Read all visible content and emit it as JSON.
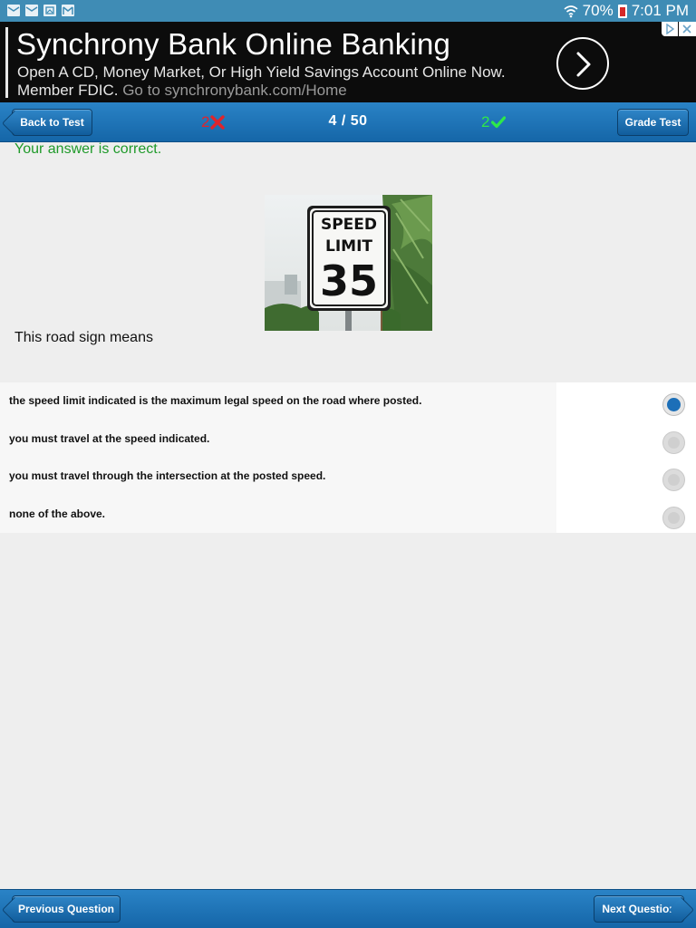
{
  "status_bar": {
    "battery": "70%",
    "time": "7:01 PM",
    "notification_icons": [
      "mail-icon",
      "mail-icon",
      "image-icon",
      "gmail-icon"
    ]
  },
  "ad": {
    "title": "Synchrony Bank Online Banking",
    "line1": "Open A CD, Money Market, Or High Yield Savings Account Online Now.",
    "line2_prefix": "Member FDIC.",
    "line2_url": "Go to synchronybank.com/Home"
  },
  "header": {
    "back_label": "Back to Test",
    "wrong_count": "2",
    "progress": "4 / 50",
    "correct_count": "2",
    "grade_label": "Grade Test"
  },
  "question": {
    "feedback": "Your answer is correct.",
    "sign_line1": "SPEED",
    "sign_line2": "LIMIT",
    "sign_number": "35",
    "prompt": "This road sign means",
    "answers": [
      {
        "text": "the speed limit indicated is the maximum legal speed on the road where posted.",
        "selected": true
      },
      {
        "text": "you must travel at the speed indicated.",
        "selected": false
      },
      {
        "text": "you must travel through the intersection at the posted speed.",
        "selected": false
      },
      {
        "text": "none of the above.",
        "selected": false
      }
    ]
  },
  "footer": {
    "prev_label": "Previous Question",
    "next_label": "Next Question"
  },
  "colors": {
    "bar_blue": "#1a6fb0",
    "correct_green": "#1f9a2a",
    "wrong_red": "#e0242b",
    "check_green": "#2ee84a",
    "selected_radio": "#1c6fb8"
  }
}
